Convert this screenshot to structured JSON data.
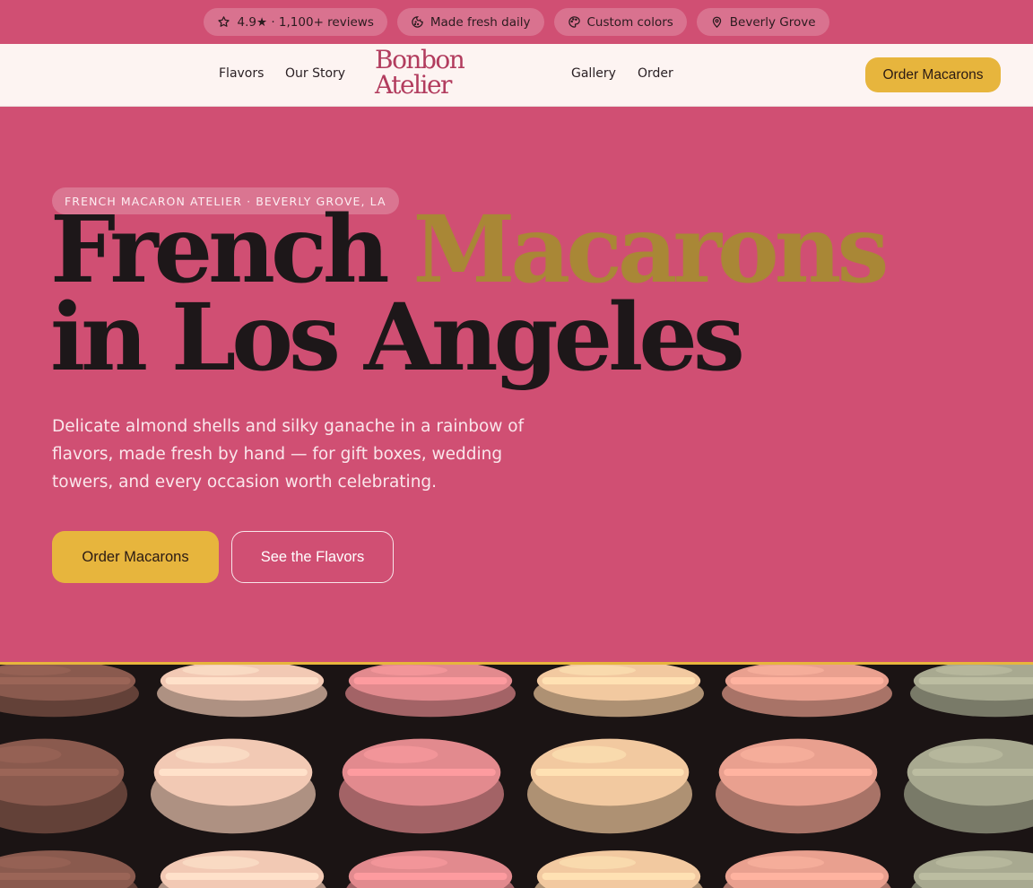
{
  "topbar": {
    "badges": [
      {
        "icon": "star-icon",
        "label": "4.9★ · 1,100+ reviews"
      },
      {
        "icon": "cookie-icon",
        "label": "Made fresh daily"
      },
      {
        "icon": "palette-icon",
        "label": "Custom colors"
      },
      {
        "icon": "map-pin-icon",
        "label": "Beverly Grove"
      }
    ]
  },
  "nav": {
    "links_left": [
      "Flavors",
      "Our Story"
    ],
    "logo_line1": "Bonbon",
    "logo_line2": "Atelier",
    "links_right": [
      "Gallery",
      "Order"
    ],
    "cta_label": "Order Macarons"
  },
  "hero": {
    "eyebrow": "FRENCH MACARON ATELIER · BEVERLY GROVE, LA",
    "headline_part1": "French ",
    "headline_accent": "Macarons",
    "headline_part2": " in Los Angeles",
    "lede": "Delicate almond shells and silky ganache in a rainbow of flavors, made fresh by hand — for gift boxes, wedding towers, and every occasion worth celebrating.",
    "primary_button": "Order Macarons",
    "secondary_button": "See the Flavors"
  },
  "colors": {
    "brand_pink": "#d04f73",
    "accent_gold": "#e7b53d",
    "headline_gold": "#a98736",
    "nav_background": "#fdf4f2",
    "logo": "#b23c5e"
  },
  "photo": {
    "icon": "macaron-photo",
    "macaron_colors": [
      "#8a5a4e",
      "#f2c9b4",
      "#e28a8e",
      "#f2c9a0",
      "#e9a08f",
      "#a8a990"
    ]
  }
}
